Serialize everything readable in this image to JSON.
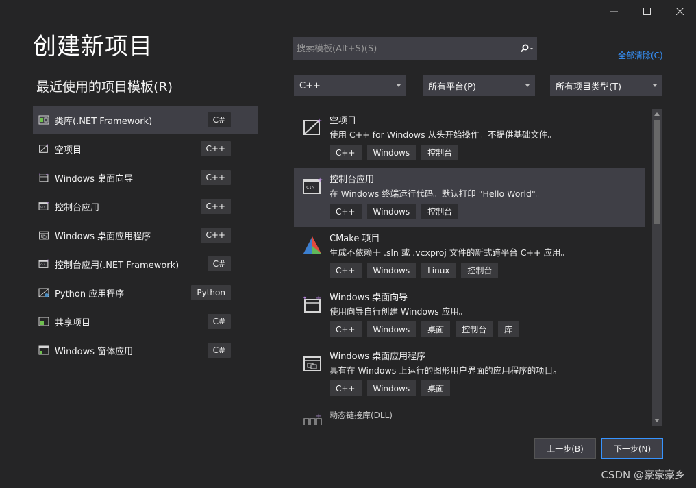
{
  "window_controls": {
    "minimize_icon": "minimize-icon",
    "maximize_icon": "maximize-icon",
    "close_icon": "close-icon"
  },
  "page_title": "创建新项目",
  "recent": {
    "title": "最近使用的项目模板(R)",
    "items": [
      {
        "label": "类库(.NET Framework)",
        "badge": "C#",
        "icon": "class-library-icon"
      },
      {
        "label": "空项目",
        "badge": "C++",
        "icon": "empty-project-icon"
      },
      {
        "label": "Windows 桌面向导",
        "badge": "C++",
        "icon": "desktop-wizard-icon"
      },
      {
        "label": "控制台应用",
        "badge": "C++",
        "icon": "console-app-icon"
      },
      {
        "label": "Windows 桌面应用程序",
        "badge": "C++",
        "icon": "desktop-app-icon"
      },
      {
        "label": "控制台应用(.NET Framework)",
        "badge": "C#",
        "icon": "console-app-icon"
      },
      {
        "label": "Python 应用程序",
        "badge": "Python",
        "icon": "python-app-icon"
      },
      {
        "label": "共享项目",
        "badge": "C#",
        "icon": "shared-project-icon"
      },
      {
        "label": "Windows 窗体应用",
        "badge": "C#",
        "icon": "forms-app-icon"
      }
    ]
  },
  "search": {
    "placeholder": "搜索模板(Alt+S)(S)",
    "icon": "search-icon"
  },
  "clear_all": "全部清除(C)",
  "filters": {
    "language": "C++",
    "platform": "所有平台(P)",
    "project_type": "所有项目类型(T)"
  },
  "templates": [
    {
      "name": "空项目",
      "desc": "使用 C++ for Windows 从头开始操作。不提供基础文件。",
      "tags": [
        "C++",
        "Windows",
        "控制台"
      ],
      "icon": "empty-project-icon"
    },
    {
      "name": "控制台应用",
      "desc": "在 Windows 终端运行代码。默认打印 \"Hello World\"。",
      "tags": [
        "C++",
        "Windows",
        "控制台"
      ],
      "icon": "console-app-icon"
    },
    {
      "name": "CMake 项目",
      "desc": "生成不依赖于 .sln 或 .vcxproj 文件的新式跨平台 C++ 应用。",
      "tags": [
        "C++",
        "Windows",
        "Linux",
        "控制台"
      ],
      "icon": "cmake-icon"
    },
    {
      "name": "Windows 桌面向导",
      "desc": "使用向导自行创建 Windows 应用。",
      "tags": [
        "C++",
        "Windows",
        "桌面",
        "控制台",
        "库"
      ],
      "icon": "desktop-wizard-icon"
    },
    {
      "name": "Windows 桌面应用程序",
      "desc": "具有在 Windows 上运行的图形用户界面的应用程序的项目。",
      "tags": [
        "C++",
        "Windows",
        "桌面"
      ],
      "icon": "desktop-app-icon"
    },
    {
      "name": "动态链接库(DLL)",
      "desc": "",
      "tags": [],
      "icon": "dll-icon"
    }
  ],
  "buttons": {
    "back": "上一步(B)",
    "next": "下一步(N)"
  },
  "watermark": "CSDN @豪豪豪乡",
  "colors": {
    "accent": "#3794ff",
    "background": "#252526",
    "selected": "#3f3f46"
  }
}
